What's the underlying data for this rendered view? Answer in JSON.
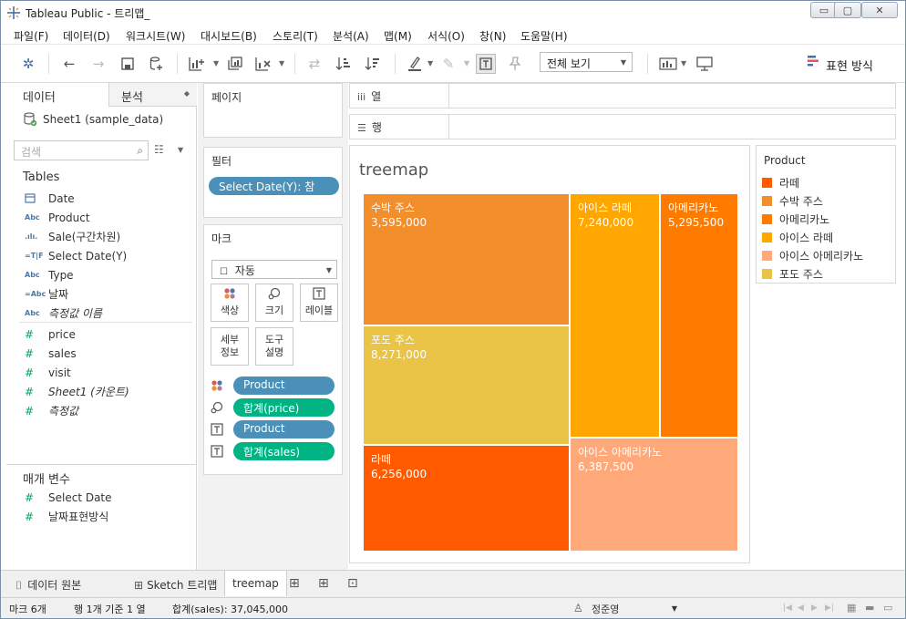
{
  "window": {
    "title": "Tableau Public - 트리맵_"
  },
  "menu": [
    "파일(F)",
    "데이터(D)",
    "워크시트(W)",
    "대시보드(B)",
    "스토리(T)",
    "분석(A)",
    "맵(M)",
    "서식(O)",
    "창(N)",
    "도움말(H)"
  ],
  "toolbar": {
    "view_mode": "전체 보기",
    "show_me": "표현 방식"
  },
  "data_pane": {
    "tab_data": "데이터",
    "tab_analysis": "분석",
    "datasource": "Sheet1 (sample_data)",
    "search_placeholder": "검색",
    "tables_title": "Tables",
    "dimensions": [
      {
        "icon": "calendar-icon",
        "type": "",
        "name": "Date"
      },
      {
        "icon": "abc-icon",
        "type": "Abc",
        "name": "Product"
      },
      {
        "icon": "bins-icon",
        "type": ".ılı.",
        "name": "Sale(구간차원)"
      },
      {
        "icon": "boolean-icon",
        "type": "=T|F",
        "name": "Select Date(Y)"
      },
      {
        "icon": "abc-icon",
        "type": "Abc",
        "name": "Type"
      },
      {
        "icon": "calc-abc-icon",
        "type": "=Abc",
        "name": "날짜"
      },
      {
        "icon": "abc-icon",
        "type": "Abc",
        "name": "측정값 이름"
      }
    ],
    "measures": [
      {
        "icon": "number-icon",
        "name": "price"
      },
      {
        "icon": "number-icon",
        "name": "sales"
      },
      {
        "icon": "number-icon",
        "name": "visit"
      },
      {
        "icon": "number-icon",
        "name": "Sheet1 (카운트)"
      },
      {
        "icon": "number-icon",
        "name": "측정값"
      }
    ],
    "params_title": "매개 변수",
    "parameters": [
      {
        "icon": "number-icon",
        "name": "Select Date"
      },
      {
        "icon": "number-icon",
        "name": "날짜표현방식"
      }
    ]
  },
  "cards": {
    "pages_title": "페이지",
    "filters_title": "필터",
    "filter_pill": "Select Date(Y): 참",
    "marks_title": "마크",
    "mark_type": "자동",
    "buttons": [
      {
        "label": "색상",
        "icon": "color-icon"
      },
      {
        "label": "크기",
        "icon": "size-icon"
      },
      {
        "label": "레이블",
        "icon": "label-icon"
      },
      {
        "label": "세부\n정보",
        "icon": "detail-icon"
      },
      {
        "label": "도구\n설명",
        "icon": "tooltip-icon"
      }
    ],
    "mark_pills": [
      {
        "icon": "color-icon",
        "label": "Product",
        "kind": "dim"
      },
      {
        "icon": "size-icon",
        "label": "합계(price)",
        "kind": "meas"
      },
      {
        "icon": "label-icon",
        "label": "Product",
        "kind": "dim"
      },
      {
        "icon": "label-icon",
        "label": "합계(sales)",
        "kind": "meas"
      }
    ]
  },
  "shelves": {
    "columns": "열",
    "rows": "행"
  },
  "viz": {
    "title": "treemap",
    "tiles": [
      {
        "name": "수박 주스",
        "value": "3,595,000",
        "color": "#F28E2B"
      },
      {
        "name": "포도 주스",
        "value": "8,271,000",
        "color": "#E9C446"
      },
      {
        "name": "라떼",
        "value": "6,256,000",
        "color": "#FF5A00"
      },
      {
        "name": "아이스 라떼",
        "value": "7,240,000",
        "color": "#FFA600"
      },
      {
        "name": "아메리카노",
        "value": "5,295,500",
        "color": "#FF7B00"
      },
      {
        "name": "아이스 아메리카노",
        "value": "6,387,500",
        "color": "#FFA97A"
      }
    ]
  },
  "legend": {
    "title": "Product",
    "items": [
      {
        "label": "라떼",
        "color": "#FF5A00"
      },
      {
        "label": "수박 주스",
        "color": "#F28E2B"
      },
      {
        "label": "아메리카노",
        "color": "#FF7B00"
      },
      {
        "label": "아이스 라떼",
        "color": "#FFA600"
      },
      {
        "label": "아이스 아메리카노",
        "color": "#FFA97A"
      },
      {
        "label": "포도 주스",
        "color": "#E9C446"
      }
    ]
  },
  "sheet_tabs": {
    "datasource": "데이터 원본",
    "sheet1": "Sketch 트리맵",
    "sheet2": "treemap"
  },
  "status": {
    "marks": "마크 6개",
    "rows_cols": "행 1개 기준 1 열",
    "sum": "합계(sales): 37,045,000",
    "user": "정준영"
  }
}
